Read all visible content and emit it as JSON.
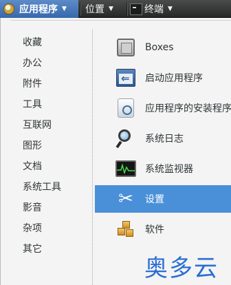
{
  "panel": {
    "applications_label": "应用程序",
    "places_label": "位置",
    "terminal_label": "终端",
    "arrow": "▼"
  },
  "categories": [
    {
      "label": "收藏"
    },
    {
      "label": "办公"
    },
    {
      "label": "附件"
    },
    {
      "label": "工具"
    },
    {
      "label": "互联网"
    },
    {
      "label": "图形"
    },
    {
      "label": "文档"
    },
    {
      "label": "系统工具"
    },
    {
      "label": "影音"
    },
    {
      "label": "杂项"
    },
    {
      "label": "其它"
    }
  ],
  "apps": [
    {
      "label": "Boxes",
      "icon": "boxes-icon"
    },
    {
      "label": "启动应用程序",
      "icon": "startup-applications-icon"
    },
    {
      "label": "应用程序的安装程序",
      "icon": "software-installer-icon"
    },
    {
      "label": "系统日志",
      "icon": "system-log-icon"
    },
    {
      "label": "系统监视器",
      "icon": "system-monitor-icon"
    },
    {
      "label": "设置",
      "icon": "settings-tools-icon",
      "selected": true
    },
    {
      "label": "软件",
      "icon": "software-icon"
    }
  ],
  "watermark": "奥多云",
  "colors": {
    "selection": "#4a90d9",
    "watermark": "#2b6ed3",
    "panel": "#2f3131"
  }
}
